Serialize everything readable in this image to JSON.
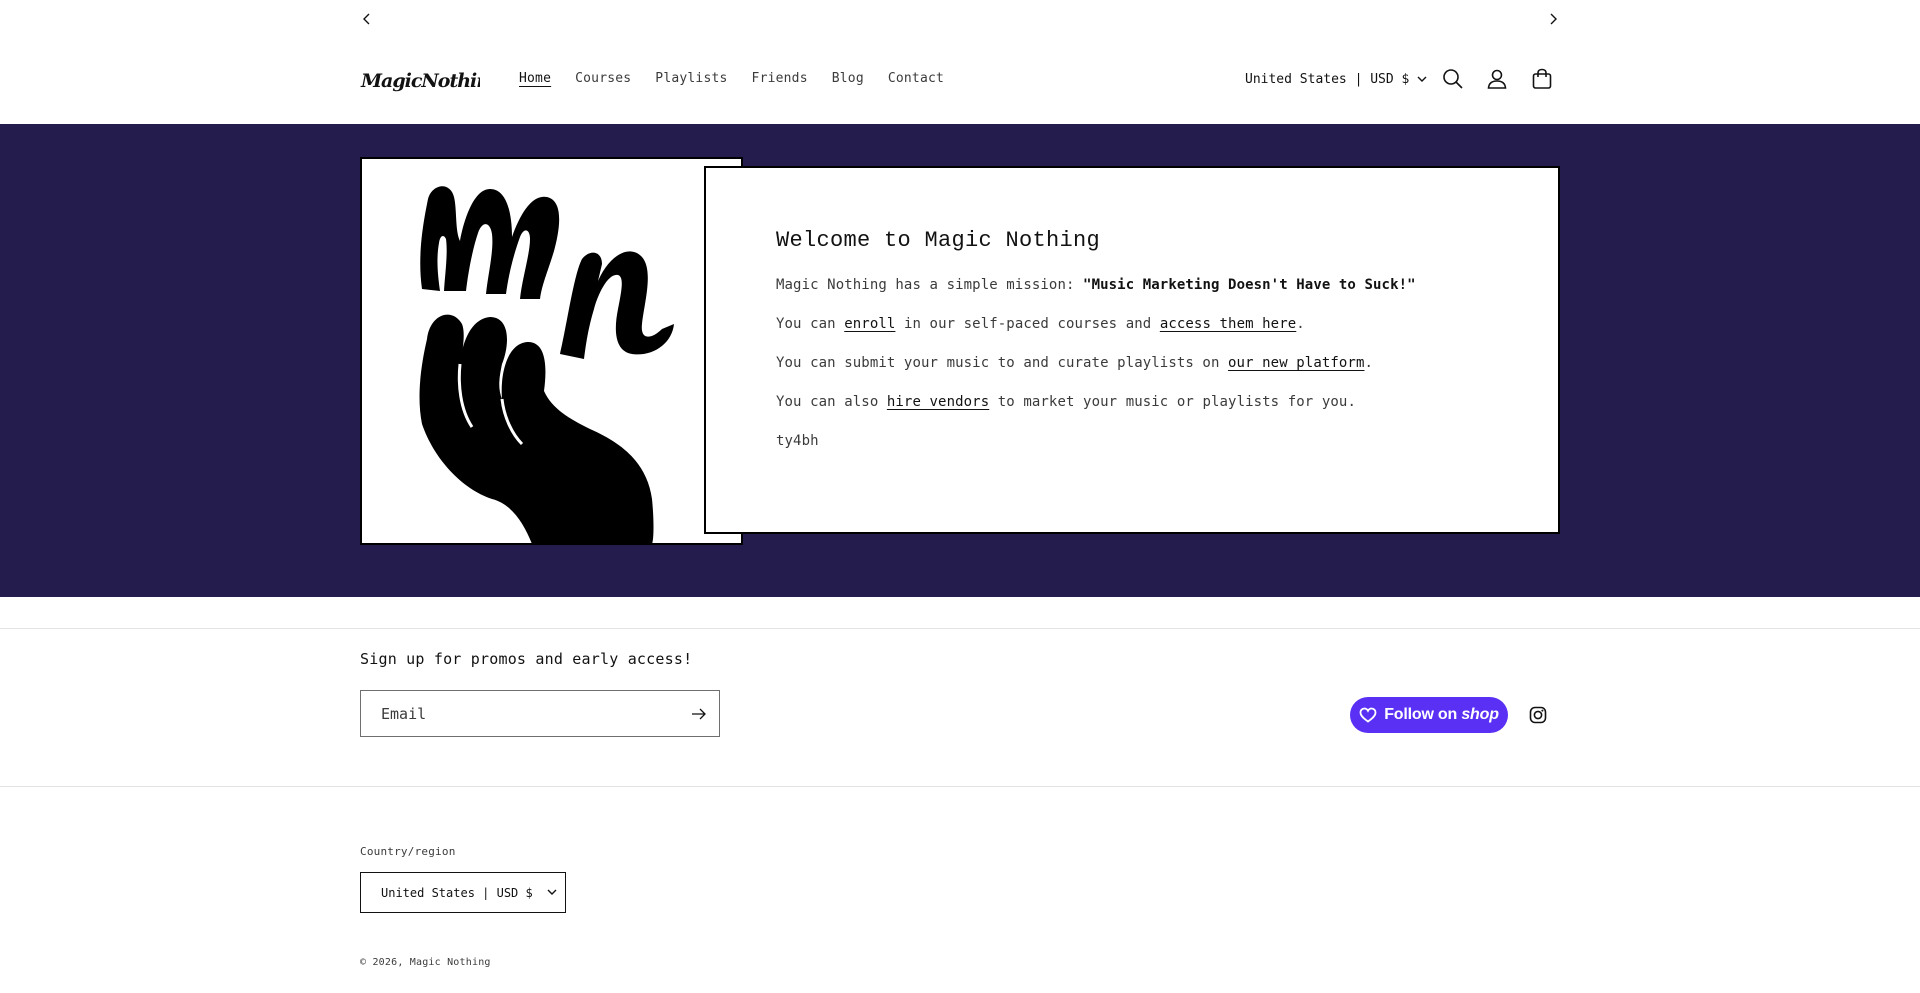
{
  "announcement": {
    "prev_label": "Previous announcement",
    "next_label": "Next announcement"
  },
  "header": {
    "logo_text": "MagicNothing",
    "nav": [
      {
        "label": "Home",
        "active": true
      },
      {
        "label": "Courses"
      },
      {
        "label": "Playlists"
      },
      {
        "label": "Friends"
      },
      {
        "label": "Blog"
      },
      {
        "label": "Contact"
      }
    ],
    "locale": "United States | USD $",
    "icons": [
      "search-icon",
      "account-icon",
      "cart-icon"
    ]
  },
  "hero": {
    "title": "Welcome to Magic Nothing",
    "mission_prefix": "Magic Nothing has a simple mission: ",
    "mission_quote": "\"Music Marketing Doesn't Have to Suck!\"",
    "line2_a": "You can ",
    "line2_link1": "enroll",
    "line2_b": " in our self-paced courses and ",
    "line2_link2": "access them here",
    "line2_c": ".",
    "line3_a": "You can submit your music to and curate playlists on ",
    "line3_link": "our new platform",
    "line3_b": ".",
    "line4_a": "You can also ",
    "line4_link": "hire vendors",
    "line4_b": " to market your music or playlists for you.",
    "line5": "ty4bh",
    "colors": {
      "background": "#231c4c",
      "card": "#ffffff"
    }
  },
  "newsletter": {
    "title": "Sign up for promos and early access!",
    "email_placeholder": "Email",
    "email_value": ""
  },
  "social": {
    "follow_prefix": "Follow on",
    "follow_shop": "shop",
    "follow_color": "#5a31f4",
    "instagram_icon": "instagram-icon"
  },
  "footer": {
    "country_label": "Country/region",
    "country_value": "United States | USD $",
    "copyright_prefix": "© 2026, ",
    "copyright_link": "Magic Nothing"
  }
}
